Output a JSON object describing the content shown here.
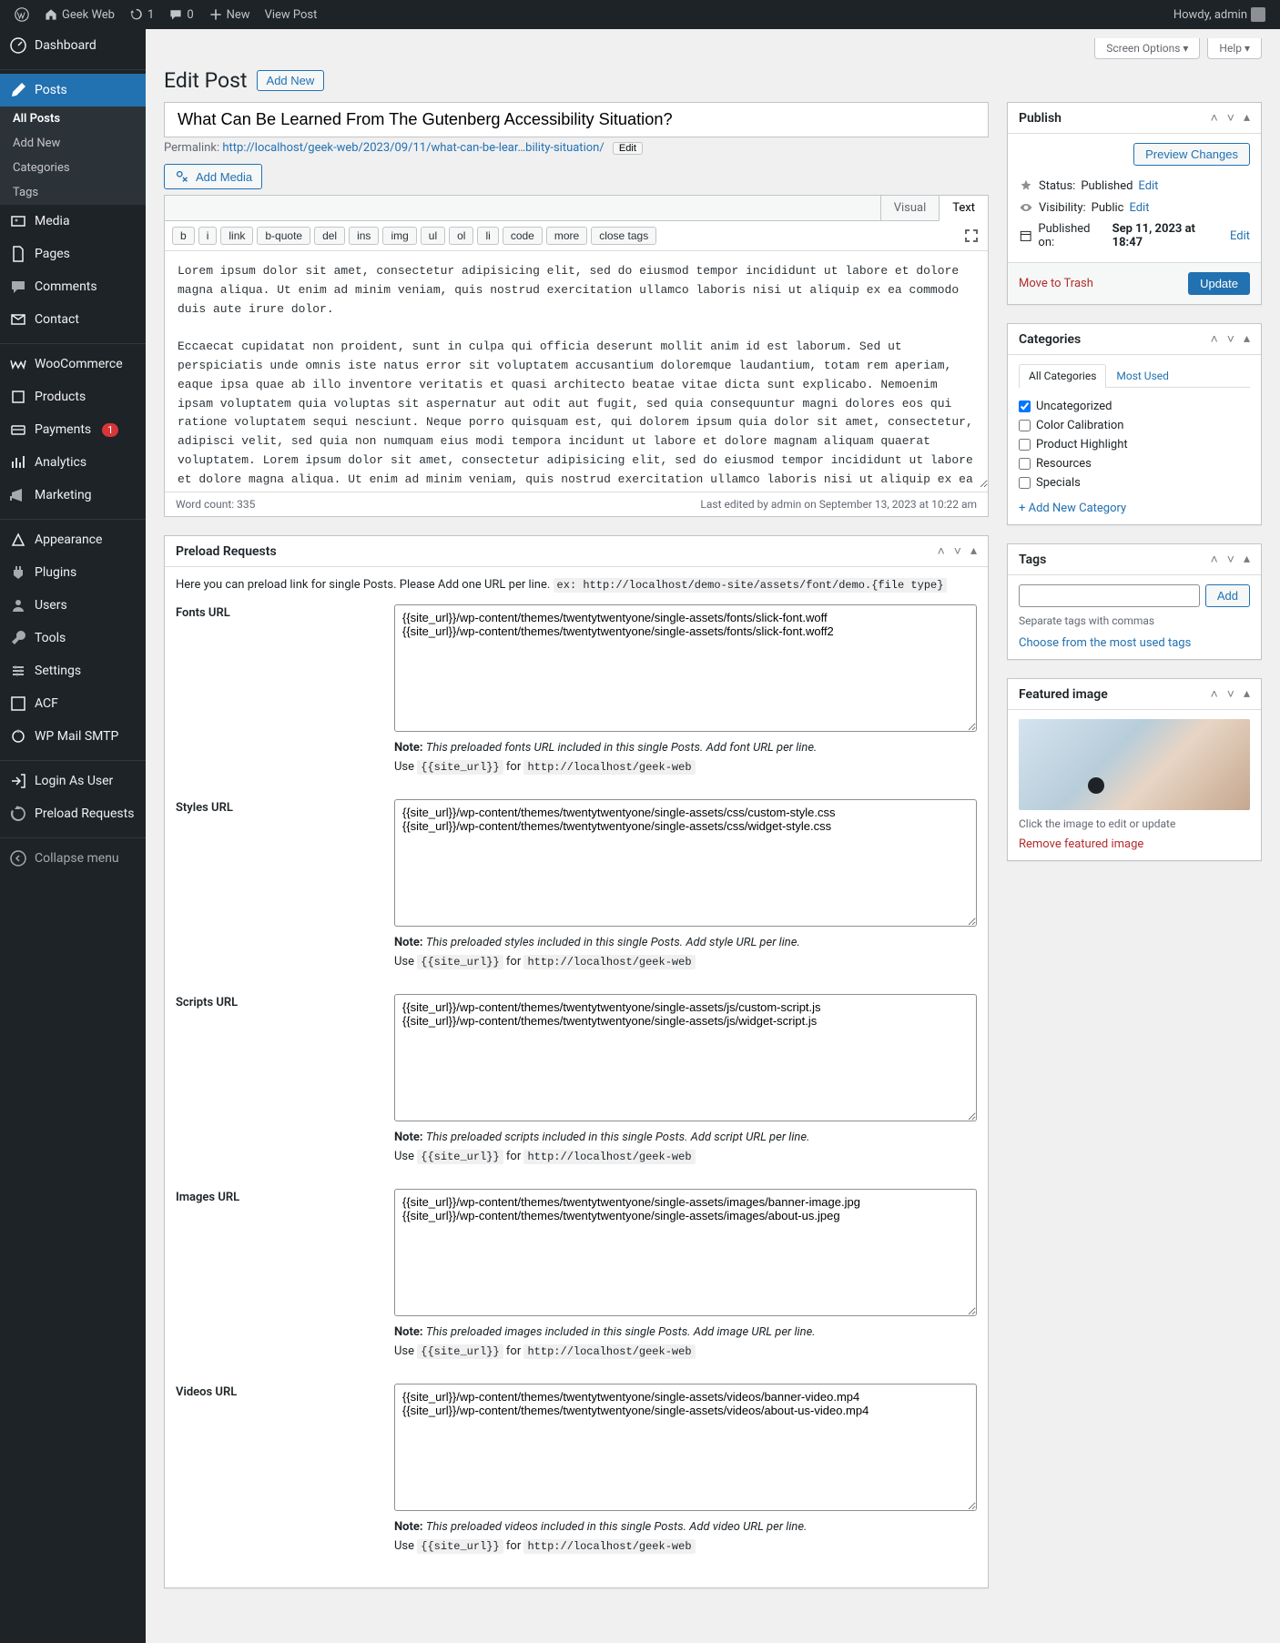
{
  "topbar": {
    "site_name": "Geek Web",
    "updates_count": "1",
    "comments_count": "0",
    "new_label": "New",
    "view_post": "View Post",
    "howdy": "Howdy, admin"
  },
  "sidebar": {
    "dashboard": "Dashboard",
    "posts": "Posts",
    "posts_sub": {
      "all": "All Posts",
      "add": "Add New",
      "cats": "Categories",
      "tags": "Tags"
    },
    "media": "Media",
    "pages": "Pages",
    "comments": "Comments",
    "contact": "Contact",
    "woo": "WooCommerce",
    "products": "Products",
    "payments": "Payments",
    "payments_badge": "1",
    "analytics": "Analytics",
    "marketing": "Marketing",
    "appearance": "Appearance",
    "plugins": "Plugins",
    "users": "Users",
    "tools": "Tools",
    "settings": "Settings",
    "acf": "ACF",
    "wpmail": "WP Mail SMTP",
    "login_as": "Login As User",
    "preload": "Preload Requests",
    "collapse": "Collapse menu"
  },
  "screen_meta": {
    "options": "Screen Options",
    "help": "Help"
  },
  "header": {
    "edit_post": "Edit Post",
    "add_new": "Add New",
    "title": "What Can Be Learned From The Gutenberg Accessibility Situation?",
    "permalink_label": "Permalink:",
    "permalink_url": "http://localhost/geek-web/2023/09/11/what-can-be-lear…bility-situation/",
    "edit_btn": "Edit",
    "add_media": "Add Media"
  },
  "editor": {
    "tabs": {
      "visual": "Visual",
      "text": "Text"
    },
    "qt": [
      "b",
      "i",
      "link",
      "b-quote",
      "del",
      "ins",
      "img",
      "ul",
      "ol",
      "li",
      "code",
      "more",
      "close tags"
    ],
    "content": "Lorem ipsum dolor sit amet, consectetur adipisicing elit, sed do eiusmod tempor incididunt ut labore et dolore magna aliqua. Ut enim ad minim veniam, quis nostrud exercitation ullamco laboris nisi ut aliquip ex ea commodo duis aute irure dolor.\n\nEccaecat cupidatat non proident, sunt in culpa qui officia deserunt mollit anim id est laborum. Sed ut perspiciatis unde omnis iste natus error sit voluptatem accusantium doloremque laudantium, totam rem aperiam, eaque ipsa quae ab illo inventore veritatis et quasi architecto beatae vitae dicta sunt explicabo. Nemoenim ipsam voluptatem quia voluptas sit aspernatur aut odit aut fugit, sed quia consequuntur magni dolores eos qui ratione voluptatem sequi nesciunt. Neque porro quisquam est, qui dolorem ipsum quia dolor sit amet, consectetur, adipisci velit, sed quia non numquam eius modi tempora incidunt ut labore et dolore magnam aliquam quaerat voluptatem. Lorem ipsum dolor sit amet, consectetur adipisicing elit, sed do eiusmod tempor incididunt ut labore et dolore magna aliqua. Ut enim ad minim veniam, quis nostrud exercitation ullamco laboris nisi ut aliquip ex ea commodo consequat. Duis aute irure dolor.\n<blockquote>CSS is designed to keep your content readable. Let's explore situations in which you might encounter overflow in your web designs and how CSS has evolved to create better ways.\n\n<footer>- Salim Rana</footer></blockquote>\nTogether made firmament third male greater Lorem ipsum dolor sit amet, consectetur adipisicing elit, sed do eiusmod tempor incididunt ut labore et dolore magnaaliqua. Ut enim ad minim veniam, quis nostrud exercitation ullamco laboris nisi ut aliquip ex ea commodo consequat. Duis aute irure dolor in reprehenderit in voluptate velit esse cillum dolore eu fugiat nulla pariatur. Excepteursint occaecat cupidatat non proident, sunt in culpa qui officia.\n\nLorem ipsum dolor sit amet, consectetur adipisicing elit, sed do eiusmod tempor incididunt ut labore et dolore magnaaliqua. Ut enim ad minim veniam, quis nostrud exercitation ullamco laboris nisi utaliquip ex ea commodo consequat. Duis aute irure dolor in reprehenderit in voluptate velit esse cillum dolore eufugiat nulla pariatur. Excepteursint occaecat cupidatat non proident, sunt in culpa qui officia.",
    "word_count_label": "Word count: 335",
    "last_edited": "Last edited by admin on September 13, 2023 at 10:22 am"
  },
  "preload": {
    "box_title": "Preload Requests",
    "intro": "Here you can preload link for single Posts. Please Add one URL per line.",
    "intro_ex": "ex: http://localhost/demo-site/assets/font/demo.{file type}",
    "fields": [
      {
        "label": "Fonts URL",
        "value": "{{site_url}}/wp-content/themes/twentytwentyone/single-assets/fonts/slick-font.woff\n{{site_url}}/wp-content/themes/twentytwentyone/single-assets/fonts/slick-font.woff2",
        "note": "This preloaded fonts URL included in this single Posts. Add font URL per line."
      },
      {
        "label": "Styles URL",
        "value": "{{site_url}}/wp-content/themes/twentytwentyone/single-assets/css/custom-style.css\n{{site_url}}/wp-content/themes/twentytwentyone/single-assets/css/widget-style.css",
        "note": "This preloaded styles included in this single Posts. Add style URL per line."
      },
      {
        "label": "Scripts URL",
        "value": "{{site_url}}/wp-content/themes/twentytwentyone/single-assets/js/custom-script.js\n{{site_url}}/wp-content/themes/twentytwentyone/single-assets/js/widget-script.js",
        "note": "This preloaded scripts included in this single Posts. Add script URL per line."
      },
      {
        "label": "Images URL",
        "value": "{{site_url}}/wp-content/themes/twentytwentyone/single-assets/images/banner-image.jpg\n{{site_url}}/wp-content/themes/twentytwentyone/single-assets/images/about-us.jpeg",
        "note": "This preloaded images included in this single Posts. Add image URL per line."
      },
      {
        "label": "Videos URL",
        "value": "{{site_url}}/wp-content/themes/twentytwentyone/single-assets/videos/banner-video.mp4\n{{site_url}}/wp-content/themes/twentytwentyone/single-assets/videos/about-us-video.mp4",
        "note": "This preloaded videos included in this single Posts. Add video URL per line."
      }
    ],
    "use_prefix": "Use ",
    "use_code": "{{site_url}}",
    "use_mid": " for ",
    "use_url": "http://localhost/geek-web",
    "note_prefix": "Note:"
  },
  "publish": {
    "title": "Publish",
    "preview": "Preview Changes",
    "status_label": "Status:",
    "status_val": "Published",
    "visibility_label": "Visibility:",
    "visibility_val": "Public",
    "published_label": "Published on:",
    "published_val": "Sep 11, 2023 at 18:47",
    "edit": "Edit",
    "trash": "Move to Trash",
    "update": "Update"
  },
  "categories": {
    "title": "Categories",
    "tab_all": "All Categories",
    "tab_used": "Most Used",
    "items": [
      {
        "label": "Uncategorized",
        "checked": true
      },
      {
        "label": "Color Calibration",
        "checked": false
      },
      {
        "label": "Product Highlight",
        "checked": false
      },
      {
        "label": "Resources",
        "checked": false
      },
      {
        "label": "Specials",
        "checked": false
      }
    ],
    "add_new": "+ Add New Category"
  },
  "tags": {
    "title": "Tags",
    "add": "Add",
    "hint": "Separate tags with commas",
    "choose": "Choose from the most used tags"
  },
  "featured": {
    "title": "Featured image",
    "click_hint": "Click the image to edit or update",
    "remove": "Remove featured image"
  }
}
